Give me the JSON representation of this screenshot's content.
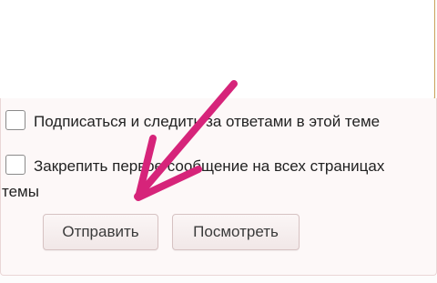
{
  "editor": {
    "value": ""
  },
  "options": {
    "subscribe_label": "Подписаться и следить за ответами в этой теме",
    "pin_label_line1": "Закрепить первое сообщение на всех страницах",
    "pin_label_line2": "темы",
    "subscribe_checked": false,
    "pin_checked": false
  },
  "actions": {
    "submit_label": "Отправить",
    "preview_label": "Посмотреть"
  },
  "colors": {
    "annotation_arrow": "#d6247a",
    "editor_border": "#c9a35c"
  }
}
